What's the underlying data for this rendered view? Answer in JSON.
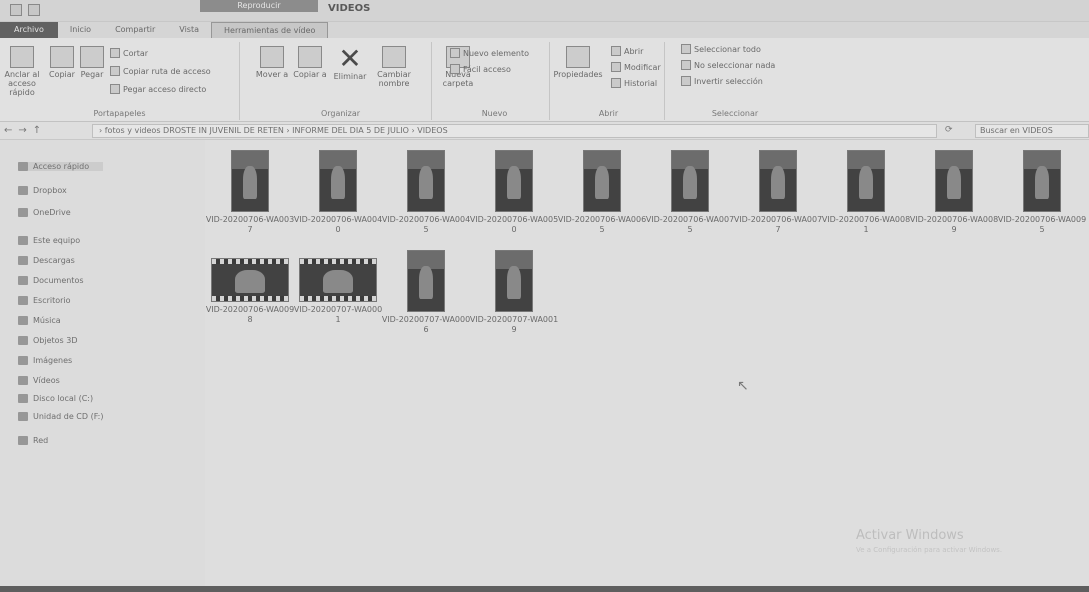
{
  "window": {
    "title": "VIDEOS",
    "context_tab_header": "Reproducir"
  },
  "tabs": [
    "Archivo",
    "Inicio",
    "Compartir",
    "Vista",
    "Herramientas de vídeo"
  ],
  "ribbon": {
    "portapapeles": {
      "label": "Portapapeles",
      "anclar": "Anclar al acceso rápido",
      "copiar": "Copiar",
      "pegar": "Pegar",
      "cortar": "Cortar",
      "copiar_ruta": "Copiar ruta de acceso",
      "pegar_acceso": "Pegar acceso directo"
    },
    "organizar": {
      "label": "Organizar",
      "mover": "Mover a",
      "copiar_a": "Copiar a",
      "eliminar": "Eliminar",
      "cambiar_nombre": "Cambiar nombre"
    },
    "nuevo": {
      "label": "Nuevo",
      "nueva_carpeta": "Nueva carpeta",
      "nuevo_elemento": "Nuevo elemento",
      "facil_acceso": "Fácil acceso"
    },
    "abrir": {
      "label": "Abrir",
      "propiedades": "Propiedades",
      "abrir": "Abrir",
      "modificar": "Modificar",
      "historial": "Historial"
    },
    "seleccionar": {
      "label": "Seleccionar",
      "todo": "Seleccionar todo",
      "nada": "No seleccionar nada",
      "invertir": "Invertir selección"
    }
  },
  "address": {
    "path": "› fotos y videos DROSTE IN JUVENIL DE RETEN › INFORME DEL DIA 5 DE JULIO › VIDEOS",
    "search_placeholder": "Buscar en VIDEOS"
  },
  "sidebar": {
    "items": [
      "Acceso rápido",
      "Dropbox",
      "OneDrive",
      "Este equipo",
      "Descargas",
      "Documentos",
      "Escritorio",
      "Música",
      "Objetos 3D",
      "Imágenes",
      "Vídeos",
      "Disco local (C:)",
      "Unidad de CD (F:)",
      "Red"
    ]
  },
  "files": [
    {
      "name": "VID-20200706-WA0037",
      "kind": "portrait"
    },
    {
      "name": "VID-20200706-WA0040",
      "kind": "portrait"
    },
    {
      "name": "VID-20200706-WA0045",
      "kind": "portrait"
    },
    {
      "name": "VID-20200706-WA0050",
      "kind": "portrait"
    },
    {
      "name": "VID-20200706-WA0065",
      "kind": "portrait"
    },
    {
      "name": "VID-20200706-WA0075",
      "kind": "portrait"
    },
    {
      "name": "VID-20200706-WA0077",
      "kind": "portrait"
    },
    {
      "name": "VID-20200706-WA0081",
      "kind": "portrait"
    },
    {
      "name": "VID-20200706-WA0089",
      "kind": "portrait"
    },
    {
      "name": "VID-20200706-WA0095",
      "kind": "portrait"
    },
    {
      "name": "VID-20200706-WA0098",
      "kind": "landscape"
    },
    {
      "name": "VID-20200707-WA0001",
      "kind": "landscape"
    },
    {
      "name": "VID-20200707-WA0006",
      "kind": "portrait"
    },
    {
      "name": "VID-20200707-WA0019",
      "kind": "portrait"
    }
  ],
  "watermark": {
    "title": "Activar Windows",
    "subtitle": "Ve a Configuración para activar Windows."
  }
}
